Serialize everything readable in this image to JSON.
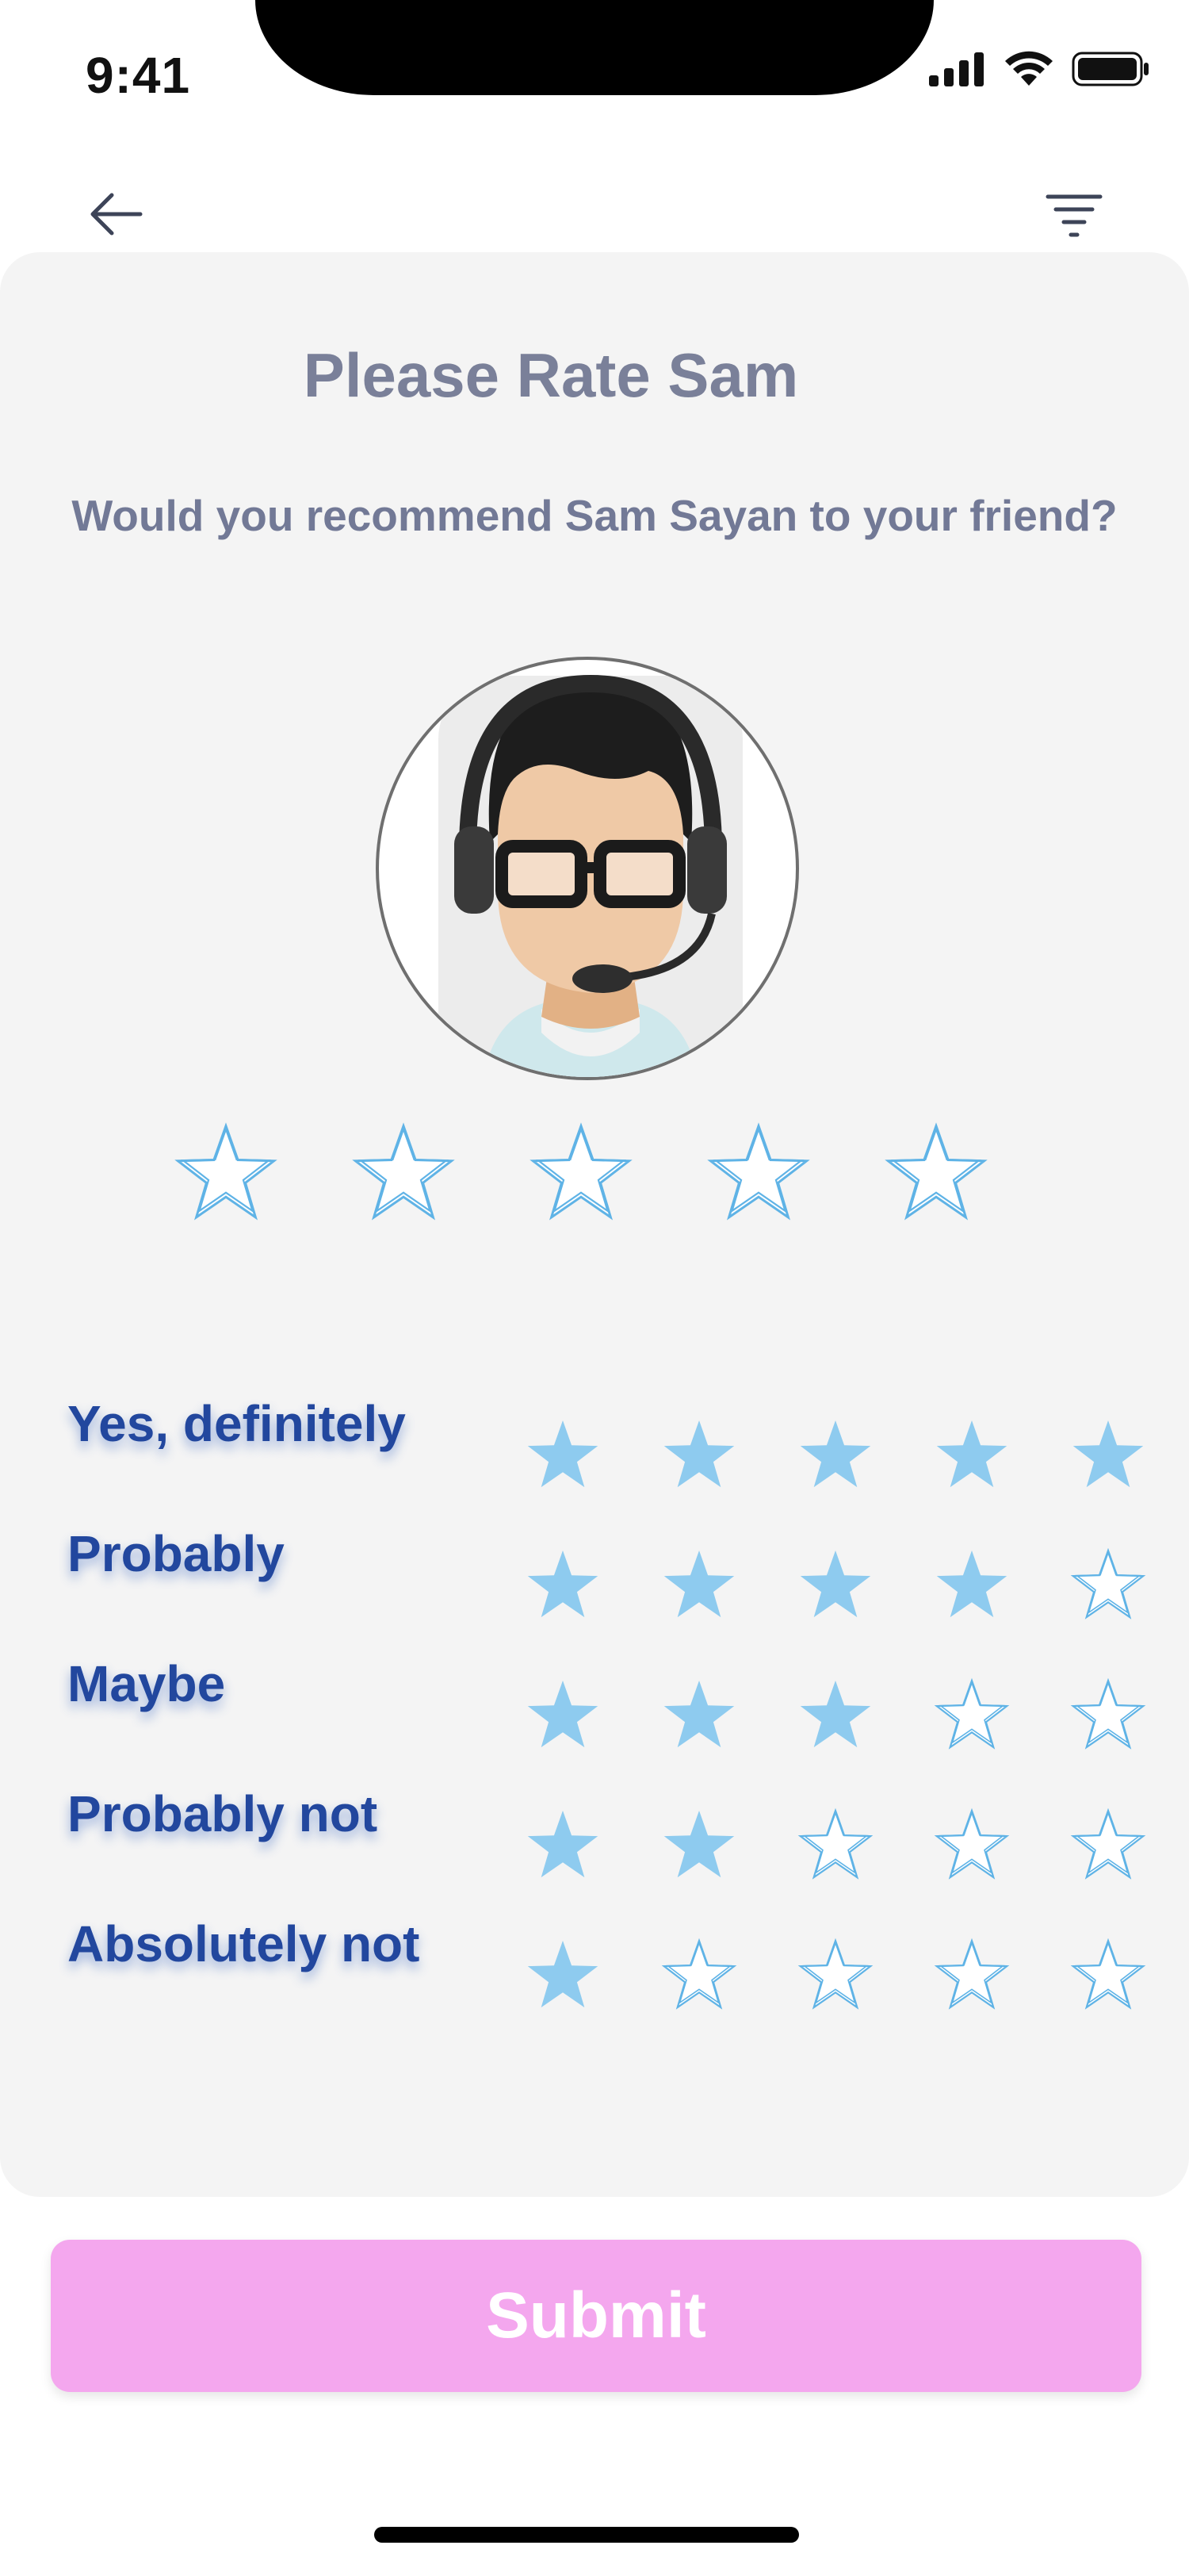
{
  "status_bar": {
    "time": "9:41",
    "icons": [
      "signal-icon",
      "wifi-icon",
      "battery-icon"
    ]
  },
  "nav": {
    "back_icon": "arrow-left-icon",
    "filter_icon": "filter-icon"
  },
  "card": {
    "title": "Please Rate Sam",
    "question": "Would you recommend Sam Sayan to your friend?",
    "avatar_icon": "support-agent-avatar",
    "rating": {
      "selected": 0,
      "max": 5
    }
  },
  "legend": [
    {
      "label": "Yes, definitely",
      "stars": 5
    },
    {
      "label": "Probably",
      "stars": 4
    },
    {
      "label": "Maybe",
      "stars": 3
    },
    {
      "label": "Probably not",
      "stars": 2
    },
    {
      "label": "Absolutely not",
      "stars": 1
    }
  ],
  "submit_label": "Submit",
  "colors": {
    "accent_pink": "#f4a7ee",
    "label_blue": "#22479e",
    "star_fill": "#8ecbef",
    "star_outline": "#5fb3e6",
    "title_gray": "#7a8099",
    "card_bg": "#f4f4f4"
  }
}
